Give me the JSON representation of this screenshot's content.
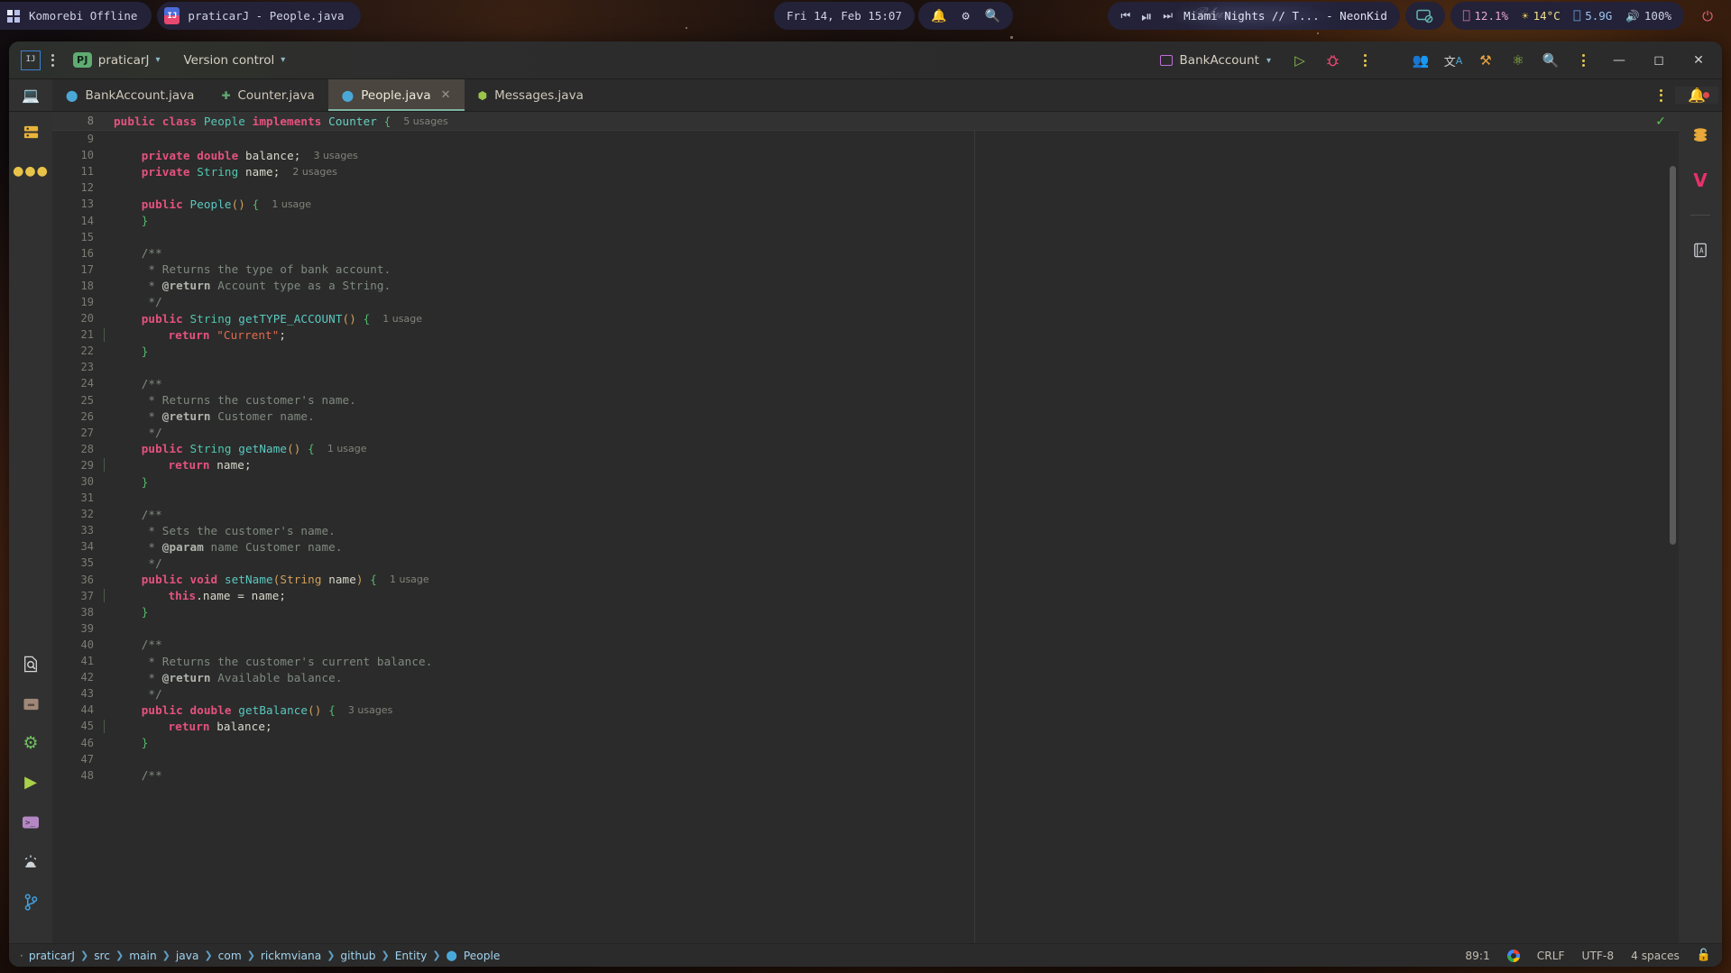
{
  "topbar": {
    "workspace": {
      "label": "Komorebi Offline",
      "icon": "grid-icon"
    },
    "active_window": {
      "label": "praticarJ - People.java",
      "icon": "intellij-icon"
    },
    "clock": "Fri 14, Feb 15:07",
    "tray": [
      "bell-icon",
      "gear-icon",
      "search-icon"
    ],
    "media": {
      "prev": "previous-track-icon",
      "playpause": "pause-icon",
      "next": "next-track-icon",
      "now_playing": "Miami Nights // T... - NeonKid"
    },
    "screen_icon": "screen-cast-icon",
    "stats": [
      {
        "name": "cpu",
        "icon": "cpu-icon",
        "value": "12.1%",
        "color": "#e27ab8"
      },
      {
        "name": "temperature",
        "icon": "sun-icon",
        "value": "14°C",
        "color": "#e8d14c"
      },
      {
        "name": "memory",
        "icon": "memory-icon",
        "value": "5.9G",
        "color": "#6fa8e8"
      },
      {
        "name": "volume",
        "icon": "speaker-icon",
        "value": "100%",
        "color": "#cfd2e6"
      }
    ],
    "power_icon": "power-icon"
  },
  "ide": {
    "header": {
      "app_icon": "intellij-logo-icon",
      "main_menu_icon": "hamburger-menu-icon",
      "project_badge": "PJ",
      "project_name": "praticarJ",
      "version_control": "Version control",
      "run_config": "BankAccount",
      "run_icon": "run-icon",
      "debug_icon": "debug-icon",
      "more_icon": "more-options-icon",
      "right_icons": [
        "users-icon",
        "translate-icon",
        "tools-icon",
        "atom-icon",
        "search-icon",
        "more-vertical-icon"
      ],
      "window_buttons": [
        "minimize-icon",
        "maximize-icon",
        "close-icon"
      ]
    },
    "tabs": [
      {
        "label": "BankAccount.java",
        "icon": "java-class-icon",
        "active": false,
        "closable": false
      },
      {
        "label": "Counter.java",
        "icon": "java-interface-icon",
        "active": false,
        "closable": false
      },
      {
        "label": "People.java",
        "icon": "java-class-icon",
        "active": true,
        "closable": true
      },
      {
        "label": "Messages.java",
        "icon": "java-enum-icon",
        "active": false,
        "closable": false
      }
    ],
    "tabstrip_more_icon": "more-vertical-icon",
    "left_rail": [
      {
        "name": "project-tool-window",
        "icon": "monitor-icon"
      },
      {
        "name": "commit-tool-window",
        "icon": "database-icon"
      },
      {
        "name": "more-tool-windows",
        "icon": "ellipsis-icon"
      },
      {
        "name": "find-tool-window",
        "icon": "find-in-files-icon"
      },
      {
        "name": "build-tool-window",
        "icon": "package-icon"
      },
      {
        "name": "services-tool-window",
        "icon": "gear-icon"
      },
      {
        "name": "run-tool-window",
        "icon": "run-icon"
      },
      {
        "name": "terminal-tool-window",
        "icon": "terminal-icon"
      },
      {
        "name": "problems-tool-window",
        "icon": "alarm-icon"
      },
      {
        "name": "git-tool-window",
        "icon": "git-branch-icon"
      }
    ],
    "right_rail": [
      {
        "name": "notifications",
        "icon": "bell-icon",
        "badge": true
      },
      {
        "name": "database-tool-window",
        "icon": "database-stack-icon"
      },
      {
        "name": "vue-tool-window",
        "icon": "v-mark-icon"
      },
      {
        "name": "dictionary-tool-window",
        "icon": "book-icon"
      }
    ],
    "editor": {
      "sticky_line": {
        "number": "8",
        "text": "public class People implements Counter {",
        "hint": "5 usages"
      },
      "inspection_status_icon": "check-icon",
      "lines": [
        {
          "n": "9",
          "tokens": []
        },
        {
          "n": "10",
          "tokens": [
            {
              "t": "    ",
              "c": ""
            },
            {
              "t": "private",
              "c": "kw"
            },
            {
              "t": " ",
              "c": ""
            },
            {
              "t": "double",
              "c": "kw"
            },
            {
              "t": " ",
              "c": ""
            },
            {
              "t": "balance",
              "c": "fld"
            },
            {
              "t": ";",
              "c": "fld"
            }
          ],
          "hint": "3 usages"
        },
        {
          "n": "11",
          "tokens": [
            {
              "t": "    ",
              "c": ""
            },
            {
              "t": "private",
              "c": "kw"
            },
            {
              "t": " ",
              "c": ""
            },
            {
              "t": "String",
              "c": "typ"
            },
            {
              "t": " ",
              "c": ""
            },
            {
              "t": "name",
              "c": "fld"
            },
            {
              "t": ";",
              "c": "fld"
            }
          ],
          "hint": "2 usages"
        },
        {
          "n": "12",
          "tokens": []
        },
        {
          "n": "13",
          "tokens": [
            {
              "t": "    ",
              "c": ""
            },
            {
              "t": "public",
              "c": "kw"
            },
            {
              "t": " ",
              "c": ""
            },
            {
              "t": "People",
              "c": "mth"
            },
            {
              "t": "()",
              "c": "par"
            },
            {
              "t": " ",
              "c": ""
            },
            {
              "t": "{",
              "c": "brc"
            }
          ],
          "hint": "1 usage"
        },
        {
          "n": "14",
          "tokens": [
            {
              "t": "    ",
              "c": ""
            },
            {
              "t": "}",
              "c": "brc"
            }
          ]
        },
        {
          "n": "15",
          "tokens": []
        },
        {
          "n": "16",
          "tokens": [
            {
              "t": "    ",
              "c": ""
            },
            {
              "t": "/**",
              "c": "cmt"
            }
          ]
        },
        {
          "n": "17",
          "tokens": [
            {
              "t": "     * ",
              "c": "cmt"
            },
            {
              "t": "Returns the type of bank account.",
              "c": "cmt"
            }
          ]
        },
        {
          "n": "18",
          "tokens": [
            {
              "t": "     * ",
              "c": "cmt"
            },
            {
              "t": "@return",
              "c": "tag"
            },
            {
              "t": " Account type as a String.",
              "c": "cmt"
            }
          ]
        },
        {
          "n": "19",
          "tokens": [
            {
              "t": "     */",
              "c": "cmt"
            }
          ]
        },
        {
          "n": "20",
          "tokens": [
            {
              "t": "    ",
              "c": ""
            },
            {
              "t": "public",
              "c": "kw"
            },
            {
              "t": " ",
              "c": ""
            },
            {
              "t": "String",
              "c": "typ"
            },
            {
              "t": " ",
              "c": ""
            },
            {
              "t": "getTYPE_ACCOUNT",
              "c": "mth"
            },
            {
              "t": "()",
              "c": "par"
            },
            {
              "t": " ",
              "c": ""
            },
            {
              "t": "{",
              "c": "brc"
            }
          ],
          "hint": "1 usage"
        },
        {
          "n": "21",
          "tokens": [
            {
              "t": "        ",
              "c": ""
            },
            {
              "t": "return",
              "c": "kw"
            },
            {
              "t": " ",
              "c": ""
            },
            {
              "t": "\"Current\"",
              "c": "str"
            },
            {
              "t": ";",
              "c": "fld"
            }
          ],
          "guide": true
        },
        {
          "n": "22",
          "tokens": [
            {
              "t": "    ",
              "c": ""
            },
            {
              "t": "}",
              "c": "brc"
            }
          ]
        },
        {
          "n": "23",
          "tokens": []
        },
        {
          "n": "24",
          "tokens": [
            {
              "t": "    ",
              "c": ""
            },
            {
              "t": "/**",
              "c": "cmt"
            }
          ]
        },
        {
          "n": "25",
          "tokens": [
            {
              "t": "     * ",
              "c": "cmt"
            },
            {
              "t": "Returns the customer's name.",
              "c": "cmt"
            }
          ]
        },
        {
          "n": "26",
          "tokens": [
            {
              "t": "     * ",
              "c": "cmt"
            },
            {
              "t": "@return",
              "c": "tag"
            },
            {
              "t": " Customer name.",
              "c": "cmt"
            }
          ]
        },
        {
          "n": "27",
          "tokens": [
            {
              "t": "     */",
              "c": "cmt"
            }
          ]
        },
        {
          "n": "28",
          "tokens": [
            {
              "t": "    ",
              "c": ""
            },
            {
              "t": "public",
              "c": "kw"
            },
            {
              "t": " ",
              "c": ""
            },
            {
              "t": "String",
              "c": "typ"
            },
            {
              "t": " ",
              "c": ""
            },
            {
              "t": "getName",
              "c": "mth"
            },
            {
              "t": "()",
              "c": "par"
            },
            {
              "t": " ",
              "c": ""
            },
            {
              "t": "{",
              "c": "brc"
            }
          ],
          "hint": "1 usage"
        },
        {
          "n": "29",
          "tokens": [
            {
              "t": "        ",
              "c": ""
            },
            {
              "t": "return",
              "c": "kw"
            },
            {
              "t": " ",
              "c": ""
            },
            {
              "t": "name",
              "c": "fld"
            },
            {
              "t": ";",
              "c": "fld"
            }
          ],
          "guide": true
        },
        {
          "n": "30",
          "tokens": [
            {
              "t": "    ",
              "c": ""
            },
            {
              "t": "}",
              "c": "brc"
            }
          ]
        },
        {
          "n": "31",
          "tokens": []
        },
        {
          "n": "32",
          "tokens": [
            {
              "t": "    ",
              "c": ""
            },
            {
              "t": "/**",
              "c": "cmt"
            }
          ]
        },
        {
          "n": "33",
          "tokens": [
            {
              "t": "     * ",
              "c": "cmt"
            },
            {
              "t": "Sets the customer's name.",
              "c": "cmt"
            }
          ]
        },
        {
          "n": "34",
          "tokens": [
            {
              "t": "     * ",
              "c": "cmt"
            },
            {
              "t": "@param",
              "c": "tag"
            },
            {
              "t": " name",
              "c": "cmt"
            },
            {
              "t": " Customer name.",
              "c": "cmt"
            }
          ]
        },
        {
          "n": "35",
          "tokens": [
            {
              "t": "     */",
              "c": "cmt"
            }
          ]
        },
        {
          "n": "36",
          "tokens": [
            {
              "t": "    ",
              "c": ""
            },
            {
              "t": "public",
              "c": "kw"
            },
            {
              "t": " ",
              "c": ""
            },
            {
              "t": "void",
              "c": "kw"
            },
            {
              "t": " ",
              "c": ""
            },
            {
              "t": "setName",
              "c": "mth"
            },
            {
              "t": "(",
              "c": "par"
            },
            {
              "t": "String",
              "c": "par"
            },
            {
              "t": " ",
              "c": ""
            },
            {
              "t": "name",
              "c": "fld"
            },
            {
              "t": ")",
              "c": "par"
            },
            {
              "t": " ",
              "c": ""
            },
            {
              "t": "{",
              "c": "brc"
            }
          ],
          "hint": "1 usage"
        },
        {
          "n": "37",
          "tokens": [
            {
              "t": "        ",
              "c": ""
            },
            {
              "t": "this",
              "c": "kw"
            },
            {
              "t": ".name = name;",
              "c": "fld"
            }
          ],
          "guide": true
        },
        {
          "n": "38",
          "tokens": [
            {
              "t": "    ",
              "c": ""
            },
            {
              "t": "}",
              "c": "brc"
            }
          ]
        },
        {
          "n": "39",
          "tokens": []
        },
        {
          "n": "40",
          "tokens": [
            {
              "t": "    ",
              "c": ""
            },
            {
              "t": "/**",
              "c": "cmt"
            }
          ]
        },
        {
          "n": "41",
          "tokens": [
            {
              "t": "     * ",
              "c": "cmt"
            },
            {
              "t": "Returns the customer's current balance.",
              "c": "cmt"
            }
          ]
        },
        {
          "n": "42",
          "tokens": [
            {
              "t": "     * ",
              "c": "cmt"
            },
            {
              "t": "@return",
              "c": "tag"
            },
            {
              "t": " Available balance.",
              "c": "cmt"
            }
          ]
        },
        {
          "n": "43",
          "tokens": [
            {
              "t": "     */",
              "c": "cmt"
            }
          ]
        },
        {
          "n": "44",
          "tokens": [
            {
              "t": "    ",
              "c": ""
            },
            {
              "t": "public",
              "c": "kw"
            },
            {
              "t": " ",
              "c": ""
            },
            {
              "t": "double",
              "c": "kw"
            },
            {
              "t": " ",
              "c": ""
            },
            {
              "t": "getBalance",
              "c": "mth"
            },
            {
              "t": "()",
              "c": "par"
            },
            {
              "t": " ",
              "c": ""
            },
            {
              "t": "{",
              "c": "brc"
            }
          ],
          "hint": "3 usages"
        },
        {
          "n": "45",
          "tokens": [
            {
              "t": "        ",
              "c": ""
            },
            {
              "t": "return",
              "c": "kw"
            },
            {
              "t": " ",
              "c": ""
            },
            {
              "t": "balance",
              "c": "fld"
            },
            {
              "t": ";",
              "c": "fld"
            }
          ],
          "guide": true
        },
        {
          "n": "46",
          "tokens": [
            {
              "t": "    ",
              "c": ""
            },
            {
              "t": "}",
              "c": "brc"
            }
          ]
        },
        {
          "n": "47",
          "tokens": []
        },
        {
          "n": "48",
          "tokens": [
            {
              "t": "    ",
              "c": ""
            },
            {
              "t": "/**",
              "c": "cmt"
            }
          ]
        }
      ]
    },
    "statusbar": {
      "breadcrumb": [
        "praticarJ",
        "src",
        "main",
        "java",
        "com",
        "rickmviana",
        "github",
        "Entity",
        "People"
      ],
      "breadcrumb_leaf_icon": "java-class-icon",
      "caret": "89:1",
      "google_icon": "google-icon",
      "line_separator": "CRLF",
      "encoding": "UTF-8",
      "indent": "4 spaces",
      "lock_icon": "unlocked-icon"
    }
  },
  "colors": {
    "accent_green": "#5fab72",
    "tab_active_bg": "#4a453f",
    "editor_bg": "#2b2b2b",
    "keyword": "#e5527f",
    "type": "#4ec9b0",
    "string": "#e06c4f",
    "comment": "#7f8a80"
  }
}
